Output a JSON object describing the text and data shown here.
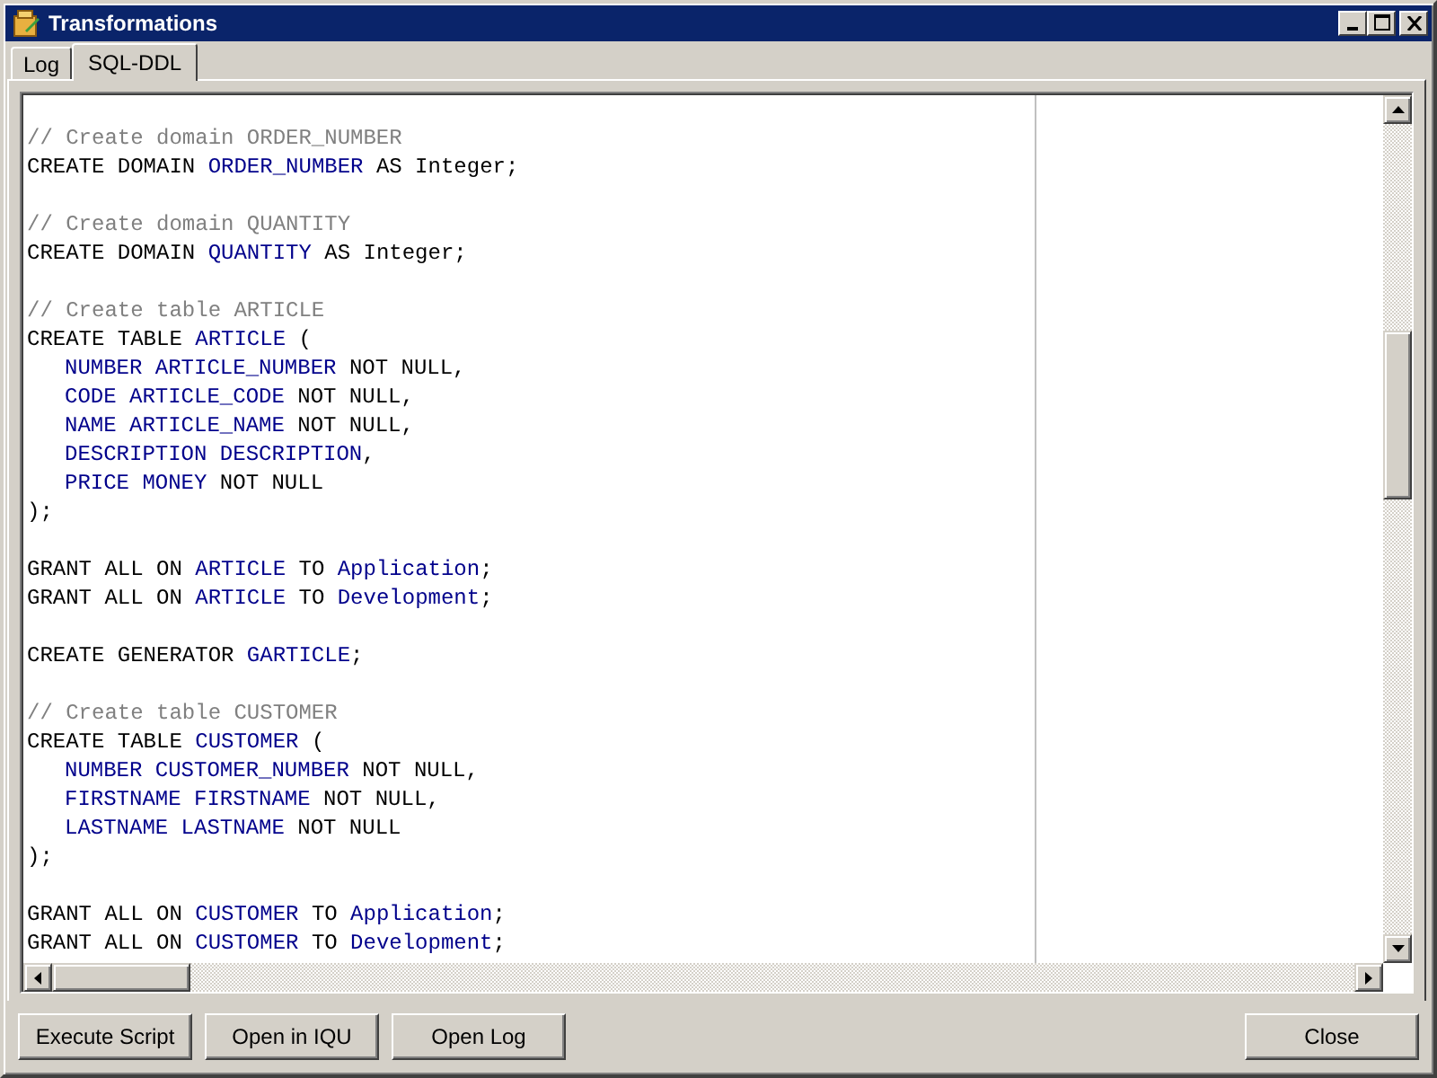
{
  "window": {
    "title": "Transformations"
  },
  "tabs": [
    {
      "label": "Log",
      "selected": false
    },
    {
      "label": "SQL-DDL",
      "selected": true
    }
  ],
  "editor": {
    "blocks": [
      [
        {
          "indented": false,
          "segments": [
            {
              "kind": "comment",
              "text": "// Create domain ORDER_NUMBER"
            }
          ]
        },
        {
          "indented": false,
          "segments": [
            {
              "kind": "plain",
              "text": "CREATE DOMAIN"
            },
            {
              "kind": "ident",
              "text": "ORDER_NUMBER"
            },
            {
              "kind": "plain",
              "text": "AS Integer;"
            }
          ]
        }
      ],
      [
        {
          "indented": false,
          "segments": [
            {
              "kind": "comment",
              "text": "// Create domain QUANTITY"
            }
          ]
        },
        {
          "indented": false,
          "segments": [
            {
              "kind": "plain",
              "text": "CREATE DOMAIN"
            },
            {
              "kind": "ident",
              "text": "QUANTITY"
            },
            {
              "kind": "plain",
              "text": "AS Integer;"
            }
          ]
        }
      ],
      [
        {
          "indented": false,
          "segments": [
            {
              "kind": "comment",
              "text": "// Create table ARTICLE"
            }
          ]
        },
        {
          "indented": false,
          "segments": [
            {
              "kind": "plain",
              "text": "CREATE TABLE"
            },
            {
              "kind": "ident",
              "text": "ARTICLE"
            },
            {
              "kind": "plain",
              "text": "("
            }
          ]
        },
        {
          "indented": true,
          "segments": [
            {
              "kind": "ident",
              "text": "NUMBER ARTICLE_NUMBER"
            },
            {
              "kind": "plain",
              "text": "NOT NULL,"
            }
          ]
        },
        {
          "indented": true,
          "segments": [
            {
              "kind": "ident",
              "text": "CODE ARTICLE_CODE"
            },
            {
              "kind": "plain",
              "text": "NOT NULL,"
            }
          ]
        },
        {
          "indented": true,
          "segments": [
            {
              "kind": "ident",
              "text": "NAME ARTICLE_NAME"
            },
            {
              "kind": "plain",
              "text": "NOT NULL,"
            }
          ]
        },
        {
          "indented": true,
          "segments": [
            {
              "kind": "ident",
              "text": "DESCRIPTION DESCRIPTION"
            },
            {
              "kind": "plain",
              "text": ","
            }
          ]
        },
        {
          "indented": true,
          "segments": [
            {
              "kind": "ident",
              "text": "PRICE MONEY"
            },
            {
              "kind": "plain",
              "text": "NOT NULL"
            }
          ]
        },
        {
          "indented": false,
          "segments": [
            {
              "kind": "plain",
              "text": ");"
            }
          ]
        }
      ],
      [
        {
          "indented": false,
          "segments": [
            {
              "kind": "plain",
              "text": "GRANT ALL ON"
            },
            {
              "kind": "ident",
              "text": "ARTICLE"
            },
            {
              "kind": "plain",
              "text": "TO"
            },
            {
              "kind": "ident",
              "text": "Application"
            },
            {
              "kind": "plain",
              "text": ";"
            }
          ]
        },
        {
          "indented": false,
          "segments": [
            {
              "kind": "plain",
              "text": "GRANT ALL ON"
            },
            {
              "kind": "ident",
              "text": "ARTICLE"
            },
            {
              "kind": "plain",
              "text": "TO"
            },
            {
              "kind": "ident",
              "text": "Development"
            },
            {
              "kind": "plain",
              "text": ";"
            }
          ]
        }
      ],
      [
        {
          "indented": false,
          "segments": [
            {
              "kind": "plain",
              "text": "CREATE GENERATOR"
            },
            {
              "kind": "ident",
              "text": "GARTICLE"
            },
            {
              "kind": "plain",
              "text": ";"
            }
          ]
        }
      ],
      [
        {
          "indented": false,
          "segments": [
            {
              "kind": "comment",
              "text": "// Create table CUSTOMER"
            }
          ]
        },
        {
          "indented": false,
          "segments": [
            {
              "kind": "plain",
              "text": "CREATE TABLE"
            },
            {
              "kind": "ident",
              "text": "CUSTOMER"
            },
            {
              "kind": "plain",
              "text": "("
            }
          ]
        },
        {
          "indented": true,
          "segments": [
            {
              "kind": "ident",
              "text": "NUMBER CUSTOMER_NUMBER"
            },
            {
              "kind": "plain",
              "text": "NOT NULL,"
            }
          ]
        },
        {
          "indented": true,
          "segments": [
            {
              "kind": "ident",
              "text": "FIRSTNAME FIRSTNAME"
            },
            {
              "kind": "plain",
              "text": "NOT NULL,"
            }
          ]
        },
        {
          "indented": true,
          "segments": [
            {
              "kind": "ident",
              "text": "LASTNAME LASTNAME"
            },
            {
              "kind": "plain",
              "text": "NOT NULL"
            }
          ]
        },
        {
          "indented": false,
          "segments": [
            {
              "kind": "plain",
              "text": ");"
            }
          ]
        }
      ],
      [
        {
          "indented": false,
          "segments": [
            {
              "kind": "plain",
              "text": "GRANT ALL ON"
            },
            {
              "kind": "ident",
              "text": "CUSTOMER"
            },
            {
              "kind": "plain",
              "text": "TO"
            },
            {
              "kind": "ident",
              "text": "Application"
            },
            {
              "kind": "plain",
              "text": ";"
            }
          ]
        },
        {
          "indented": false,
          "segments": [
            {
              "kind": "plain",
              "text": "GRANT ALL ON"
            },
            {
              "kind": "ident",
              "text": "CUSTOMER"
            },
            {
              "kind": "plain",
              "text": "TO"
            },
            {
              "kind": "ident",
              "text": "Development"
            },
            {
              "kind": "plain",
              "text": ";"
            }
          ]
        }
      ]
    ]
  },
  "buttons": [
    "Execute Script",
    "Open in IQU",
    "Open Log"
  ],
  "close_button": "Close"
}
